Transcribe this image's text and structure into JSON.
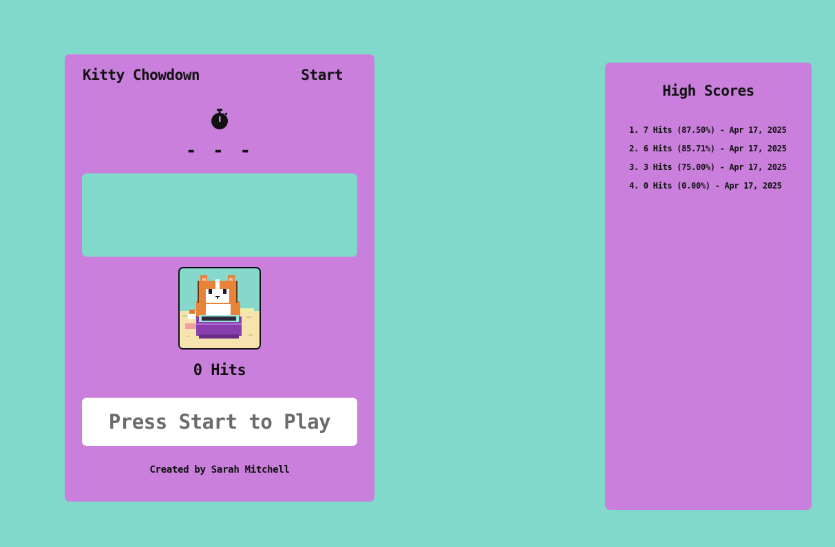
{
  "game": {
    "title": "Kitty Chowdown",
    "start_label": "Start",
    "timer_icon": "stopwatch-icon",
    "timer_text": "- - -",
    "hits_text": "0 Hits",
    "button_label": "Press Start to Play",
    "credit": "Created by Sarah Mitchell",
    "cat_image": "cat-with-bowl-pixel-art"
  },
  "high_scores": {
    "title": "High Scores",
    "entries": [
      "1. 7 Hits (87.50%) - Apr 17, 2025",
      "2. 6 Hits (85.71%) - Apr 17, 2025",
      "3. 3 Hits (75.00%) - Apr 17, 2025",
      "4. 0 Hits (0.00%) - Apr 17, 2025"
    ]
  },
  "colors": {
    "background": "#80d9cb",
    "panel": "#c97fdb",
    "button": "#ffffff",
    "button_text": "#6b6b6b",
    "text": "#111111"
  }
}
